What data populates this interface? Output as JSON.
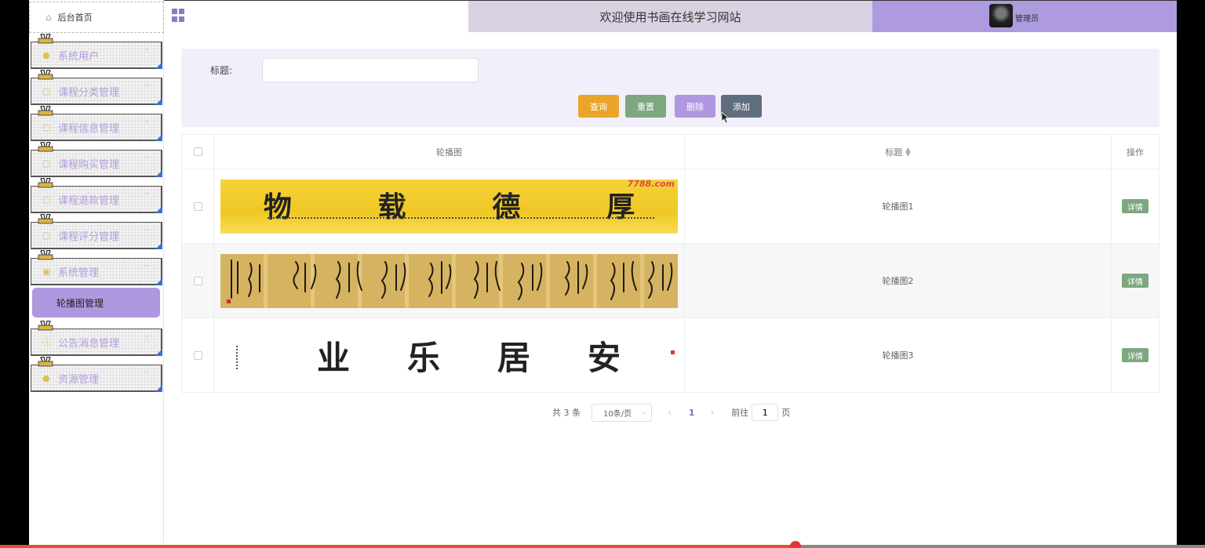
{
  "sidebar": {
    "home": "后台首页",
    "items": [
      {
        "label": "系统用户",
        "icon": "user-icon"
      },
      {
        "label": "课程分类管理",
        "icon": "document-icon"
      },
      {
        "label": "课程信息管理",
        "icon": "document-icon"
      },
      {
        "label": "课程购买管理",
        "icon": "document-icon"
      },
      {
        "label": "课程退款管理",
        "icon": "document-icon"
      },
      {
        "label": "课程评分管理",
        "icon": "document-icon"
      },
      {
        "label": "系统管理",
        "icon": "picture-icon"
      },
      {
        "label": "公告消息管理",
        "icon": "info-icon"
      },
      {
        "label": "资源管理",
        "icon": "location-icon"
      }
    ],
    "active_submenu": "轮播图管理"
  },
  "header": {
    "site_title": "欢迎使用书画在线学习网站",
    "user_name": "管理员"
  },
  "search": {
    "title_label": "标题:",
    "title_value": "",
    "buttons": {
      "query": "查询",
      "reset": "重置",
      "delete": "删除",
      "add": "添加"
    }
  },
  "table": {
    "headers": {
      "image": "轮播图",
      "title": "标题",
      "action": "操作"
    },
    "rows": [
      {
        "title": "轮播图1",
        "action": "详情",
        "image_chars": "物 载 德 厚",
        "image_logo": "7788.com"
      },
      {
        "title": "轮播图2",
        "action": "详情",
        "image_chars": "",
        "image_logo": ""
      },
      {
        "title": "轮播图3",
        "action": "详情",
        "image_chars": "业 乐 居 安",
        "image_logo": ""
      }
    ]
  },
  "pagination": {
    "total": "共 3 条",
    "page_size": "10条/页",
    "current": "1",
    "goto_label": "前往",
    "goto_value": "1",
    "suffix": "页"
  },
  "player": {
    "progress": 0.66
  },
  "colors": {
    "accent": "#ae98e0",
    "query": "#eaa42a",
    "reset": "#7ca77f",
    "add": "#5f6e7d",
    "progress": "#e84f2e"
  }
}
